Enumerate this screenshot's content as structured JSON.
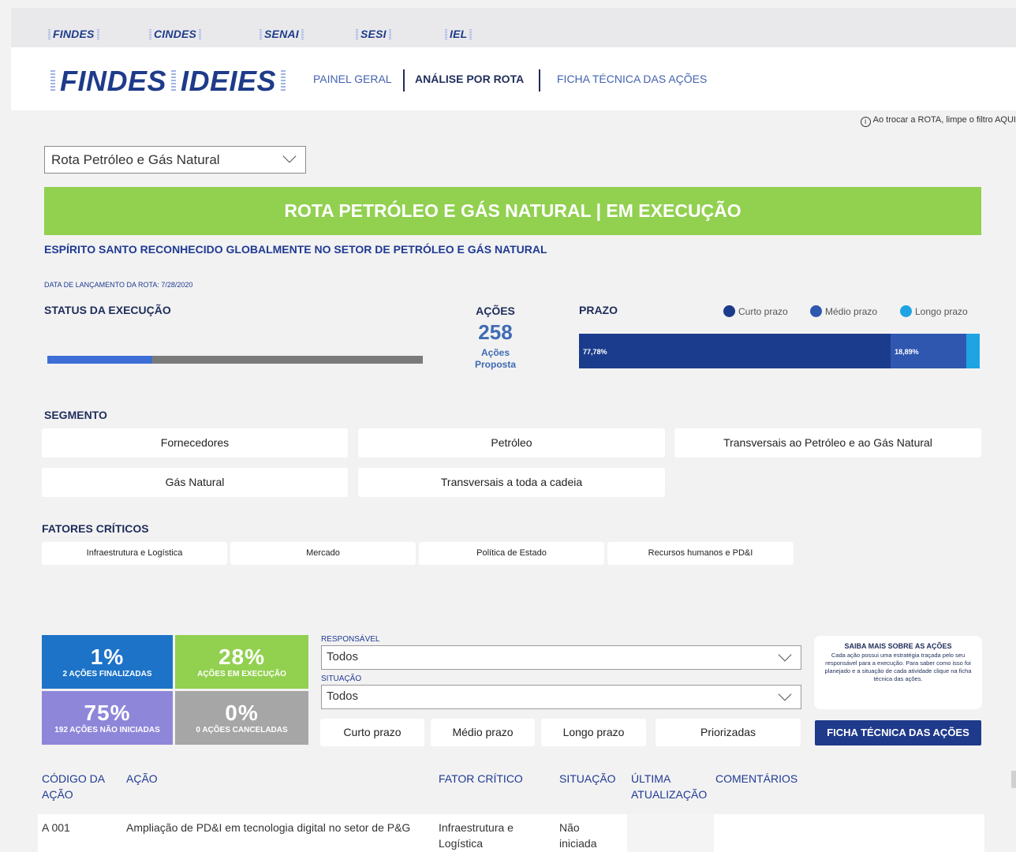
{
  "brand_bar": [
    "FINDES",
    "CINDES",
    "SENAI",
    "SESI",
    "IEL"
  ],
  "logo": {
    "part1": "FINDES",
    "part2": "IDEIES"
  },
  "nav": [
    "PAINEL GERAL",
    "ANÁLISE POR ROTA",
    "FICHA TÉCNICA DAS AÇÕES"
  ],
  "info_note": "Ao trocar a ROTA, limpe o filtro AQUI",
  "route_select": {
    "value": "Rota Petróleo e Gás Natural"
  },
  "banner": "ROTA PETRÓLEO E GÁS NATURAL | EM EXECUÇÃO",
  "subtitle": "ESPÍRITO SANTO RECONHECIDO GLOBALMENTE NO SETOR DE PETRÓLEO E GÁS NATURAL",
  "launch_date": "DATA DE LANÇAMENTO DA ROTA: 7/28/2020",
  "status": {
    "label": "STATUS DA EXECUÇÃO",
    "progress": 0.28
  },
  "acoes": {
    "title": "AÇÕES",
    "count": "258",
    "label_1": "Ações",
    "label_2": "Proposta"
  },
  "prazo": {
    "title": "PRAZO",
    "legend": [
      {
        "name": "Curto prazo",
        "color": "#1b3c8c"
      },
      {
        "name": "Médio prazo",
        "color": "#2f57b0"
      },
      {
        "name": "Longo prazo",
        "color": "#1ea4e3"
      }
    ],
    "segments": [
      {
        "value": 0.7778,
        "label": "77,78%",
        "color": "#1b3c8c"
      },
      {
        "value": 0.1889,
        "label": "18,89%",
        "color": "#2f57b0"
      },
      {
        "value": 0.0333,
        "label": "",
        "color": "#1ea4e3"
      }
    ]
  },
  "segmento": {
    "title": "SEGMENTO",
    "items": [
      "Fornecedores",
      "Petróleo",
      "Transversais ao Petróleo e ao Gás Natural",
      "Gás Natural",
      "Transversais a toda a cadeia"
    ]
  },
  "fatores": {
    "title": "FATORES CRÍTICOS",
    "items": [
      "Infraestrutura e Logística",
      "Mercado",
      "Política de Estado",
      "Recursos humanos e PD&I"
    ]
  },
  "kpis": [
    {
      "value": "1%",
      "label": "2 AÇÕES FINALIZADAS",
      "color": "#1c73c8"
    },
    {
      "value": "28%",
      "label": "AÇÕES EM EXECUÇÃO",
      "color": "#92d050"
    },
    {
      "value": "75%",
      "label": "192 AÇÕES NÃO INICIADAS",
      "color": "#8e86d9"
    },
    {
      "value": "0%",
      "label": "0 AÇÕES CANCELADAS",
      "color": "#a6a6a6"
    }
  ],
  "filters": {
    "responsavel": {
      "label": "RESPONSÁVEL",
      "value": "Todos"
    },
    "situacao": {
      "label": "SITUAÇÃO",
      "value": "Todos"
    }
  },
  "prazo_buttons": [
    "Curto prazo",
    "Médio prazo",
    "Longo prazo",
    "Priorizadas"
  ],
  "ficha_button": "FICHA TÉCNICA DAS AÇÕES",
  "info_box": {
    "title": "SAIBA MAIS SOBRE AS AÇÕES",
    "text": "Cada ação possui uma estratégia traçada pelo seu responsável para a execução. Para saber como isso foi planejado e a situação de cada atividade clique na ficha técnica das ações."
  },
  "table": {
    "headers": [
      "CÓDIGO DA AÇÃO",
      "AÇÃO",
      "FATOR CRÍTICO",
      "SITUAÇÃO",
      "ÚLTIMA ATUALIZAÇÃO",
      "COMENTÁRIOS"
    ],
    "rows": [
      {
        "codigo": "A 001",
        "acao": "Ampliação de PD&I em tecnologia digital no setor de P&G",
        "fator": "Infraestrutura e Logística",
        "situacao": "Não iniciada"
      }
    ]
  }
}
